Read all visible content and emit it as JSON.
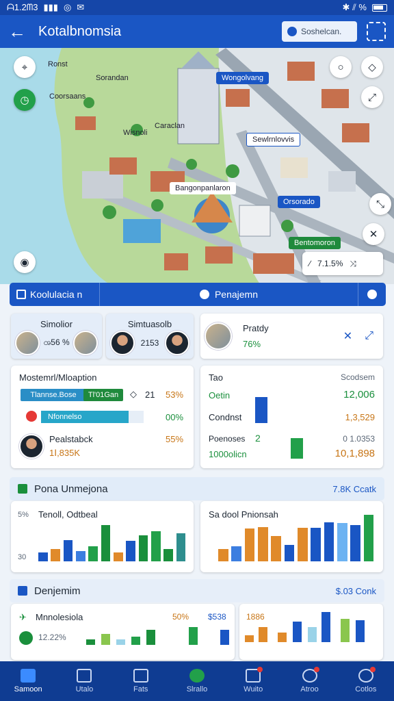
{
  "status": {
    "time": "ᗩ1.2ᗰ3",
    "indicators": "✱ ⫽ %"
  },
  "header": {
    "back_icon": "arrow-left-icon",
    "title": "Kotalbnomsia",
    "search_placeholder": "Soshelcan."
  },
  "map": {
    "labels": [
      "Ronst",
      "Coorsaans",
      "Wisnoli",
      "Caraclan",
      "Sorandan"
    ],
    "chips": [
      {
        "text": "Wongolvang",
        "color": "#1a56c4"
      },
      {
        "text": "Sewlrnlovvis",
        "color": "#ffffff"
      },
      {
        "text": "Bangonpanlaron",
        "color": "#ffffff"
      },
      {
        "text": "Orsorado",
        "color": "#1a56c4"
      },
      {
        "text": "Bentomoron",
        "color": "#1f8a3c"
      }
    ],
    "nav_card": "7.1.5%"
  },
  "tabs": {
    "left": "Koolulacia n",
    "center": "Penajemn"
  },
  "profiles": [
    {
      "title": "Simolior",
      "sub": "ၻ56 %"
    },
    {
      "title": "Simtuasolb",
      "sub": "2153"
    },
    {
      "title": "Pratdy",
      "sub": "76%"
    }
  ],
  "management": {
    "title": "Mostemrl/Mloaption",
    "tag1": "Tlannse.Bose",
    "tag2": "Tl'01Gan",
    "tag_num": "21",
    "tag_pct": "53%",
    "progress_label": "Nfonnelso",
    "progress_value": "00%",
    "progress_fraction": 0.85,
    "person_title": "Pealstabck",
    "person_value": "1Ⅰ,835K",
    "person_pct": "55%"
  },
  "stats": {
    "header_left": "Tao",
    "header_right": "Scodsem",
    "rows": [
      {
        "label": "Oetin",
        "value": "12,006",
        "color": "#1a8f3c"
      },
      {
        "label": "Condnst",
        "value": "1,3,529",
        "color": "#c77516"
      },
      {
        "label": "Poenoses",
        "num": "2",
        "value2": "0 1.0353"
      },
      {
        "label": "1000olicn",
        "value": "10,1,898",
        "color": "#c77516"
      }
    ]
  },
  "section1": {
    "title": "Pona Unmejona",
    "right": "7.8K Ccatk"
  },
  "chart1": {
    "label": "Tenoll, Odtbeal",
    "ylabels": [
      "5%",
      "30"
    ]
  },
  "chart2": {
    "label": "Sa dool Pnionsah"
  },
  "section2": {
    "title": "Denjemim",
    "right": "$.03 Conk"
  },
  "chart3": {
    "label": "Mnnolesiola",
    "v1": "50%",
    "v2": "$538",
    "pct": "12.22%"
  },
  "chart4": {
    "label": "1886"
  },
  "chart_data": [
    {
      "type": "bar",
      "series": [
        {
          "name": "",
          "values": [
            0.14,
            0.2,
            0.34,
            0.16,
            0.24,
            0.57,
            0.14,
            0.32,
            0.41,
            0.48,
            0.2,
            0.44
          ]
        }
      ],
      "colors": [
        "#1a56c4",
        "#e08a2a",
        "#1a56c4",
        "#3c7ee0",
        "#22a04a",
        "#1a8f3c",
        "#e08a2a",
        "#1a56c4",
        "#1a8f3c",
        "#22a04a",
        "#1a8f3c",
        "#2e8e8e"
      ]
    },
    {
      "type": "bar",
      "series": [
        {
          "name": "",
          "values": [
            0.2,
            0.24,
            0.52,
            0.54,
            0.4,
            0.26,
            0.53,
            0.53,
            0.62,
            0.61,
            0.57,
            0.73
          ]
        }
      ],
      "colors": [
        "#e08a2a",
        "#3c7ee0",
        "#e08a2a",
        "#e08a2a",
        "#e08a2a",
        "#1a56c4",
        "#e08a2a",
        "#1a56c4",
        "#1a56c4",
        "#6db3f2",
        "#1a56c4",
        "#22a04a"
      ]
    }
  ],
  "bottom_nav": [
    {
      "label": "Samoon",
      "active": true
    },
    {
      "label": "Utalo",
      "active": false
    },
    {
      "label": "Fats",
      "active": false
    },
    {
      "label": "Slrallo",
      "active": false
    },
    {
      "label": "Wuito",
      "active": false
    },
    {
      "label": "Atroo",
      "active": false
    },
    {
      "label": "Cotlos",
      "active": false
    }
  ]
}
